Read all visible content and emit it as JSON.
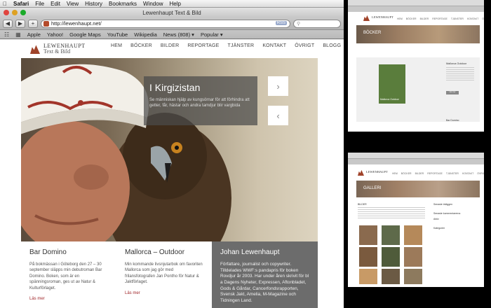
{
  "menubar": {
    "apple": "",
    "items": [
      "Safari",
      "File",
      "Edit",
      "View",
      "History",
      "Bookmarks",
      "Window",
      "Help"
    ]
  },
  "window": {
    "title": "Lewenhaupt Text & Bild"
  },
  "toolbar": {
    "back": "◀",
    "forward": "▶",
    "add": "+",
    "url": "http://lewenhaupt.net/",
    "rss": "RSS",
    "reload": "↻"
  },
  "bookmarks": {
    "items": [
      "Apple",
      "Yahoo!",
      "Google Maps",
      "YouTube",
      "Wikipedia",
      "News (808) ▾",
      "Popular ▾"
    ]
  },
  "site": {
    "logo_line1": "LEWENHAUPT",
    "logo_line2": "Text & Bild",
    "nav": [
      "HEM",
      "BÖCKER",
      "BILDER",
      "REPORTAGE",
      "TJÄNSTER",
      "KONTAKT",
      "ÖVRIGT",
      "BLOGG"
    ]
  },
  "hero": {
    "title": "I Kirgizistan",
    "subtitle": "Se människan hjälp av kungsörnar för att förhindra att getter, får, hästar och andra tamdjur blir vargbida",
    "next": "›",
    "prev": "‹"
  },
  "columns": [
    {
      "title": "Bar Domino",
      "text": "På bokmässan i Göteborg den 27 – 30 september släpps min debutroman Bar Domino. Boken, som är en spänningsroman, ges ut av Natur & Kulturförlaget.",
      "more": "Läs mer"
    },
    {
      "title": "Mallorca – Outdoor",
      "text": "Min kommande livsnjutarbok om favoriten Mallorca som jag gör med frilansfotografen Jan Pontho för Natur & Jaktförlaget.",
      "more": "Läs mer"
    },
    {
      "title": "Johan Lewenhaupt",
      "text": "Författare, journalist och copywriter. Tilldelades WWF:s pandapris för boken Rovdjur år 2003. Har under åren skrivit för bl a Dagens Nyheter, Expressen, Aftonbladet, Gods & Gårdar, Cancerfondsrapporten, Svensk Jakt, Amelia, M-Magazine och Tidningen Land."
    }
  ],
  "thumb1": {
    "banner": "BÖCKER",
    "book_title": "Mallorca Outdoor",
    "book_caption": "Mallorca Outdoor",
    "side_title": "Bar Domino",
    "button": "Läs mer"
  },
  "thumb2": {
    "banner": "GALLERI",
    "section": "BILDER",
    "side_heading1": "Senaste inläggen",
    "side_heading2": "Senaste kommentarerna",
    "side_heading3": "Arkiv",
    "side_heading4": "Kategorier"
  },
  "colors": {
    "accent": "#a0262a",
    "brand": "#a0432a",
    "dark_panel": "#6c6c6c"
  }
}
